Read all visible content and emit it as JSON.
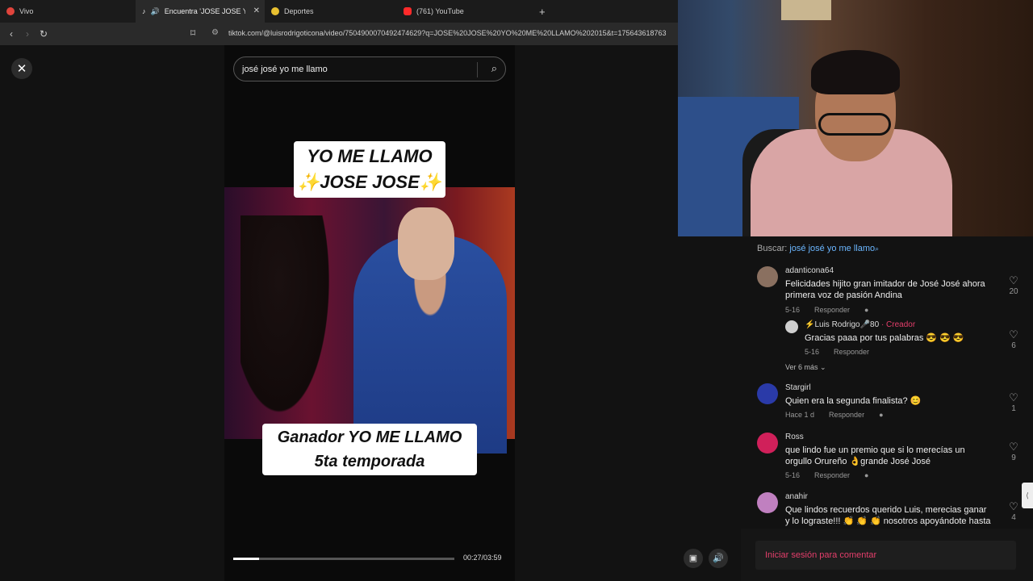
{
  "browser": {
    "tabs": [
      {
        "label": "Vivo",
        "color": "#e0443c"
      },
      {
        "label": "Encuentra 'JOSE JOSE YO ME",
        "color": "#ffffff",
        "active": true
      },
      {
        "label": "Deportes",
        "color": "#e8c030"
      },
      {
        "label": "(761) YouTube",
        "color": "#ff2a2a"
      }
    ],
    "new_tab": "+",
    "url": "tiktok.com/@luisrodrigoticona/video/7504900070492474629?q=JOSE%20JOSE%20YO%20ME%20LLAMO%202015&t=175643618763"
  },
  "video": {
    "search_value": "josé josé yo me llamo",
    "caption_top_1": "YO ME LLAMO",
    "caption_top_2": "✨JOSE JOSE✨",
    "caption_bottom_1": "Ganador YO ME LLAMO",
    "caption_bottom_2": "5ta temporada",
    "progress": 0.117,
    "time": "00:27/03:59"
  },
  "comments": {
    "buscar_label": "Buscar:",
    "buscar_query": "josé josé yo me llamo",
    "items": [
      {
        "user": "adanticona64",
        "text": "Felicidades hijito gran imitador de José José ahora primera voz de pasión Andina",
        "date": "5-16",
        "reply": "Responder",
        "likes": "20",
        "avatar": "#8a7060"
      },
      {
        "user": "⚡Luis Rodrigo🎤80",
        "creator": "· Creador",
        "text": "Gracias paaa por tus palabras 😎 😎 😎",
        "date": "5-16",
        "reply": "Responder",
        "likes": "6",
        "avatar": "#cfcfcf"
      },
      {
        "user": "Stargirl",
        "text": "Quien era la segunda finalista? 😊",
        "date": "Hace 1 d",
        "reply": "Responder",
        "likes": "1",
        "avatar": "#2a3aa8"
      },
      {
        "user": "Ross",
        "text": "que lindo fue un premio que si lo merecías un orgullo Orureño 👌grande José José",
        "date": "5-16",
        "reply": "Responder",
        "likes": "9",
        "avatar": "#d0205a"
      },
      {
        "user": "anahir",
        "text": "Que lindos recuerdos querido Luis, merecias ganar y lo lograste!!! 👏 👏 👏 nosotros apoyándote hasta",
        "likes": "4",
        "avatar": "#c080c0"
      }
    ],
    "more_replies": "Ver 6 más ⌄",
    "login": "Iniciar sesión para comentar"
  }
}
